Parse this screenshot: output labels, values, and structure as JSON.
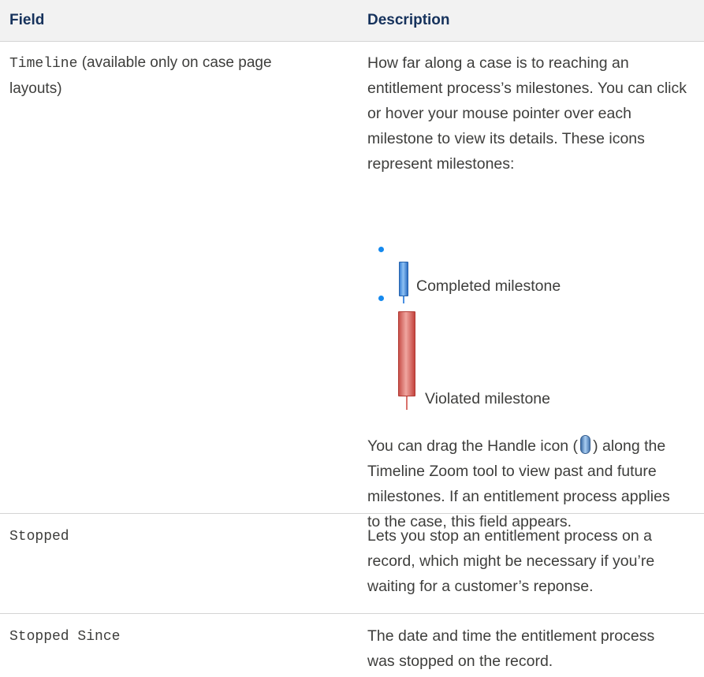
{
  "header": {
    "field": "Field",
    "description": "Description"
  },
  "rows": [
    {
      "field_mono": "Timeline",
      "field_suffix": " (available only on case page",
      "field_suffix2": "layouts)",
      "desc_lines": [
        "How far along a case is to reaching an",
        "entitlement process’s milestones. You can click",
        "or hover your mouse pointer over each",
        "milestone to view its details. These icons",
        "represent milestones:"
      ],
      "bullets": [
        {
          "label": "Completed milestone",
          "icon": "completed-milestone-icon",
          "color": "#4a90e2"
        },
        {
          "label": "Violated milestone",
          "icon": "violated-milestone-icon",
          "color": "#d9534f"
        }
      ],
      "handle_line_prefix": "You can drag the Handle icon (",
      "handle_line_suffix": ") along the",
      "after_lines": [
        "Timeline Zoom tool to view past and future",
        "milestones. If an entitlement process applies",
        "to the case, this field appears."
      ]
    },
    {
      "field_mono": "Stopped",
      "desc_lines": [
        "Lets you stop an entitlement process on a",
        "record, which might be necessary if you’re",
        "waiting for a customer’s reponse."
      ]
    },
    {
      "field_mono": "Stopped Since",
      "desc_lines": [
        "The date and time the entitlement process",
        "was stopped on the record."
      ]
    }
  ],
  "colors": {
    "header_text": "#16325c",
    "bullet": "#1589ee",
    "border": "#d4d4d4"
  }
}
